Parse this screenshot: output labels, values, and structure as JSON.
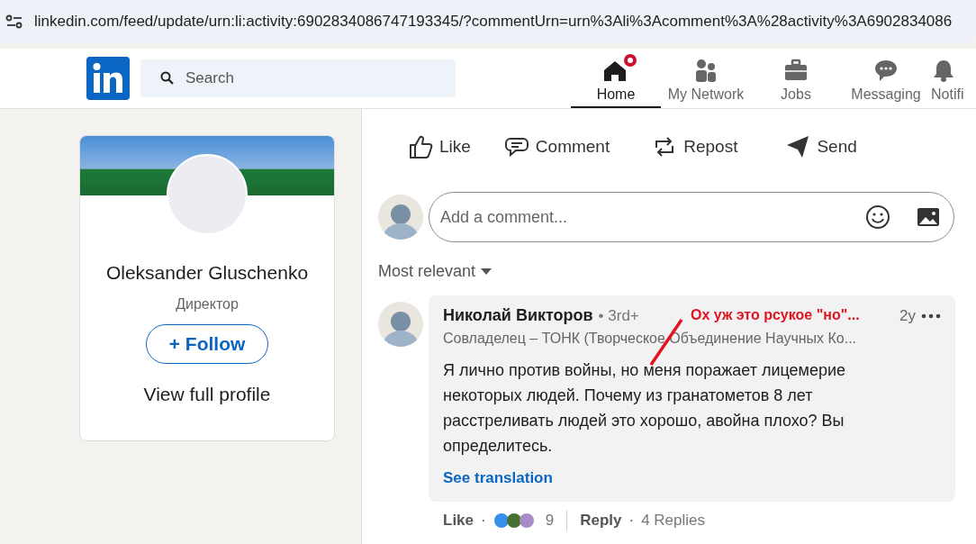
{
  "address_bar": {
    "url": "linkedin.com/feed/update/urn:li:activity:6902834086747193345/?commentUrn=urn%3Ali%3Acomment%3A%28activity%3A6902834086"
  },
  "nav": {
    "search": {
      "placeholder": "Search"
    },
    "items": [
      {
        "label": "Home",
        "kind": "home",
        "selected": true,
        "badge": true
      },
      {
        "label": "My Network",
        "kind": "network",
        "selected": false,
        "badge": false
      },
      {
        "label": "Jobs",
        "kind": "jobs",
        "selected": false,
        "badge": false
      },
      {
        "label": "Messaging",
        "kind": "messaging",
        "selected": false,
        "badge": false
      },
      {
        "label": "Notifi",
        "kind": "bell",
        "selected": false,
        "badge": false
      }
    ]
  },
  "profile_card": {
    "name": "Oleksander Gluschenko",
    "title": "Директор",
    "follow_button": "+ Follow",
    "view_profile": "View full profile"
  },
  "post_actions": [
    {
      "label": "Like",
      "kind": "like"
    },
    {
      "label": "Comment",
      "kind": "comment"
    },
    {
      "label": "Repost",
      "kind": "repost"
    },
    {
      "label": "Send",
      "kind": "send"
    }
  ],
  "comment_box": {
    "placeholder": "Add a comment..."
  },
  "sort": {
    "label": "Most relevant"
  },
  "comment": {
    "author": "Николай Викторов",
    "degree": "• 3rd+",
    "headline": "Совладелец – ТОНК (Творческое Объединение Научных Ко...",
    "time": "2y",
    "text": "Я лично против войны, но меня поражает лицемерие некоторых людей. Почему из гранатометов 8 лет расстреливать людей это хорошо, авойна плохо? Вы определитесь.",
    "translate_link": "See translation",
    "like": "Like",
    "separator_1": "·",
    "reaction_count": "9",
    "reply": "Reply",
    "separator_2": "·",
    "replies": "4 Replies"
  },
  "annotation": {
    "text": "Ох уж это рсукое \"но\"..."
  }
}
